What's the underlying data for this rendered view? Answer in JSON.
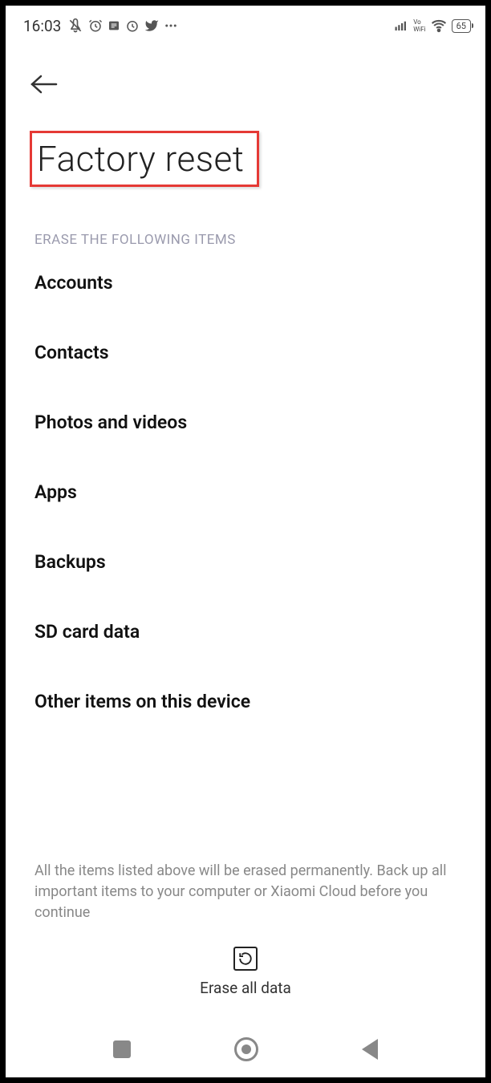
{
  "status": {
    "time": "16:03",
    "battery": "65"
  },
  "page": {
    "title": "Factory reset",
    "section_header": "ERASE THE FOLLOWING ITEMS",
    "items": [
      "Accounts",
      "Contacts",
      "Photos and videos",
      "Apps",
      "Backups",
      "SD card data",
      "Other items on this device"
    ],
    "warning": "All the items listed above will be erased permanently. Back up all important items to your computer or Xiaomi Cloud before you continue",
    "erase_button": "Erase all data"
  }
}
